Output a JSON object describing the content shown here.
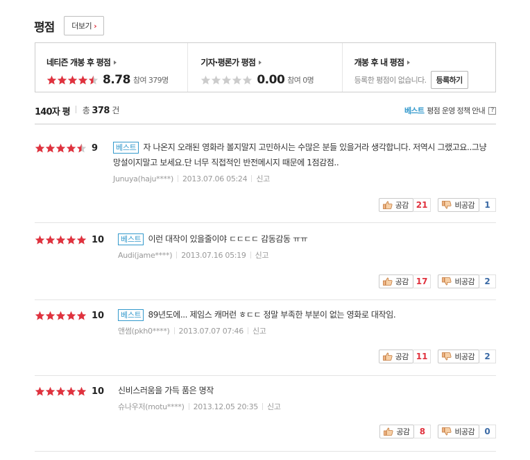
{
  "header": {
    "title": "평점",
    "more_label": "더보기"
  },
  "summary": [
    {
      "label": "네티즌 개봉 후 평점",
      "stars": 4.5,
      "score": "8.78",
      "count": "참여 379명"
    },
    {
      "label": "기자·평론가 평점",
      "stars": 0,
      "score": "0.00",
      "count": "참여 0명"
    },
    {
      "label": "개봉 후 내 평점",
      "message": "등록한 평점이 없습니다.",
      "button": "등록하기"
    }
  ],
  "list_header": {
    "title": "140자 평",
    "total_prefix": "총",
    "total_count": "378",
    "total_suffix": "건",
    "best_label": "베스트",
    "policy_label": "평점 운영 정책 안내",
    "help": "?"
  },
  "reviews": [
    {
      "stars": 4.5,
      "score": "9",
      "best": "베스트",
      "text": "자 나온지 오래된 영화라 볼지말지 고민하시는 수많은 분들 있을거라 생각합니다. 저역시 그랬고요..그냥 망설이지말고 보세요.단 너무 직접적인 반전메시지 때문에 1점감점..",
      "author": "Junuya(haju****)",
      "date": "2013.07.06 05:24",
      "report": "신고",
      "like_label": "공감",
      "like": "21",
      "dislike_label": "비공감",
      "dislike": "1"
    },
    {
      "stars": 5,
      "score": "10",
      "best": "베스트",
      "text": "이런 대작이 있을줄이야 ㄷㄷㄷㄷ 감동감동 ㅠㅠ",
      "author": "Audi(jame****)",
      "date": "2013.07.16 05:19",
      "report": "신고",
      "like_label": "공감",
      "like": "17",
      "dislike_label": "비공감",
      "dislike": "2"
    },
    {
      "stars": 5,
      "score": "10",
      "best": "베스트",
      "text": "89년도에... 제임스 캐머런 ㅎㄷㄷ 정말 부족한 부분이 없는 영화로 대작임.",
      "author": "앤썸(pkh0****)",
      "date": "2013.07.07 07:46",
      "report": "신고",
      "like_label": "공감",
      "like": "11",
      "dislike_label": "비공감",
      "dislike": "2"
    },
    {
      "stars": 5,
      "score": "10",
      "best": "",
      "text": "신비스러움을 가득 품은 명작",
      "author": "슈나우저(motu****)",
      "date": "2013.12.05 20:35",
      "report": "신고",
      "like_label": "공감",
      "like": "8",
      "dislike_label": "비공감",
      "dislike": "0"
    }
  ],
  "colors": {
    "star_on": "#e0323e",
    "star_off": "#cccccc",
    "best": "#3399cc",
    "like": "#e0323e",
    "dislike": "#3b6aa5"
  }
}
